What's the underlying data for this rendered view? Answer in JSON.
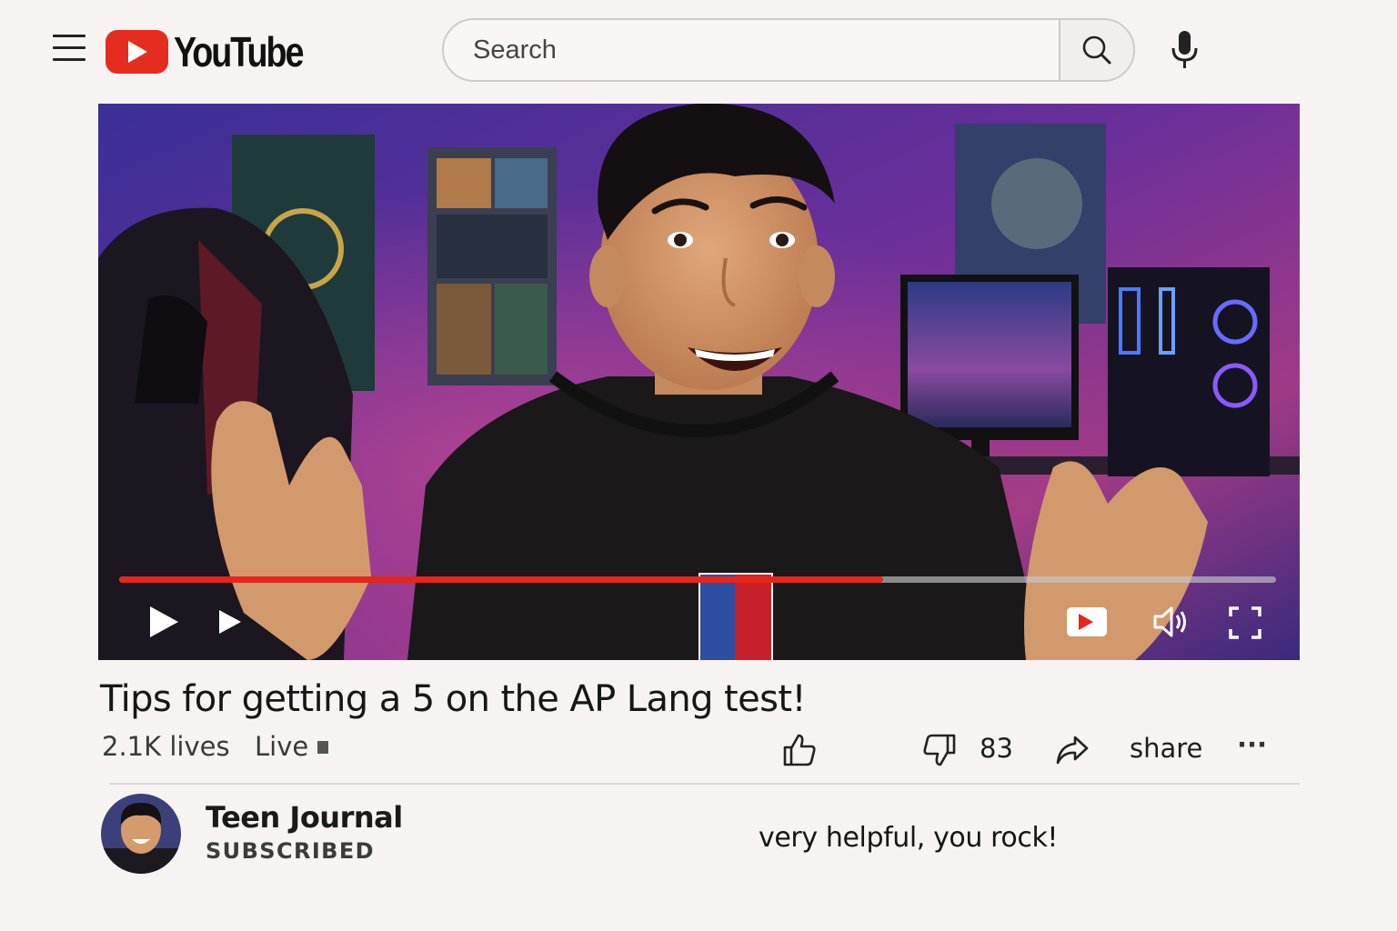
{
  "header": {
    "logo_text": "YouTube",
    "search_placeholder": "Search"
  },
  "player": {
    "progress_fraction": 0.66,
    "accent_color": "#e5261b",
    "controls": [
      "play-icon",
      "next-icon",
      "miniplayer-icon",
      "volume-icon",
      "fullscreen-icon"
    ]
  },
  "video": {
    "title": "Tips for getting a 5 on the AP Lang test!",
    "views": "2.1K lives",
    "live_label": "Live"
  },
  "actions": {
    "dislike_count": "83",
    "share_label": "share",
    "more_label": "···"
  },
  "channel": {
    "name": "Teen Journal",
    "status": "SUBSCRIBED"
  },
  "comment": {
    "text": "very helpful, you rock!"
  }
}
